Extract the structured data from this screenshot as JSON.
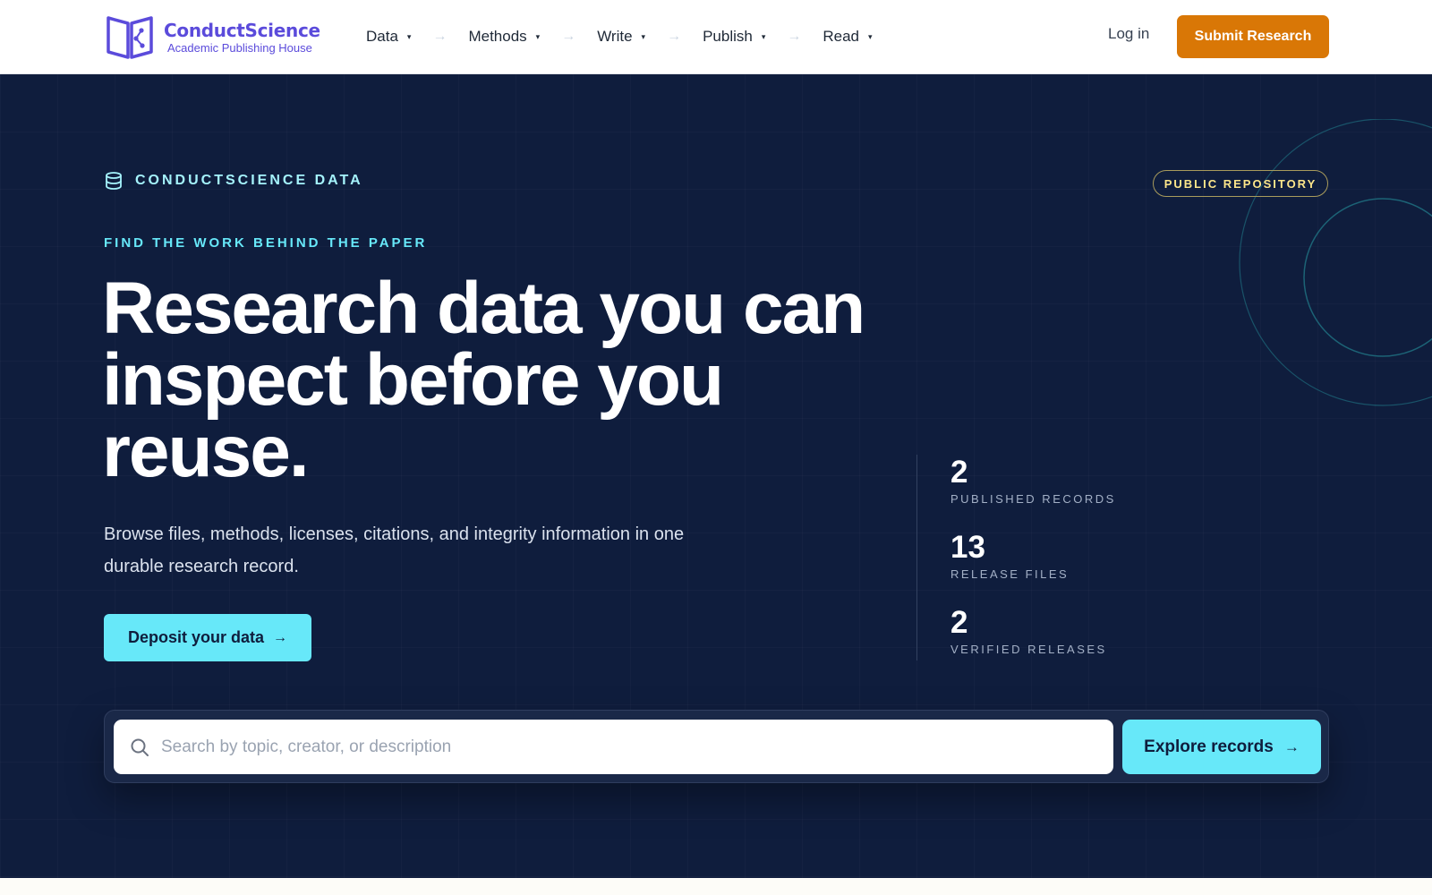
{
  "header": {
    "brand_name": "ConductScience",
    "brand_tagline": "Academic Publishing House",
    "nav": [
      {
        "label": "Data"
      },
      {
        "label": "Methods"
      },
      {
        "label": "Write"
      },
      {
        "label": "Publish"
      },
      {
        "label": "Read"
      }
    ],
    "nav_separator": "→",
    "caret": "▾",
    "login_label": "Log in",
    "submit_label": "Submit Research"
  },
  "hero": {
    "eyebrow": "CONDUCTSCIENCE DATA",
    "badge": "PUBLIC REPOSITORY",
    "kicker": "FIND THE WORK BEHIND THE PAPER",
    "headline": "Research data you can inspect before you reuse.",
    "subtext": "Browse files, methods, licenses, citations, and integrity information in one durable research record.",
    "deposit_label": "Deposit your data",
    "arrow": "→",
    "stats": [
      {
        "value": "2",
        "label": "PUBLISHED RECORDS"
      },
      {
        "value": "13",
        "label": "RELEASE FILES"
      },
      {
        "value": "2",
        "label": "VERIFIED RELEASES"
      }
    ]
  },
  "search": {
    "placeholder": "Search by topic, creator, or description",
    "value": "",
    "button_label": "Explore records"
  },
  "colors": {
    "brand": "#5b4bdb",
    "cta_orange": "#d97706",
    "hero_bg": "#0f1d3d",
    "accent_cyan": "#67e8f9",
    "badge_yellow": "#fde68a"
  },
  "icons": [
    "book-network-logo-icon",
    "nav-caret-icon",
    "database-icon",
    "search-icon",
    "arrow-right-icon"
  ]
}
